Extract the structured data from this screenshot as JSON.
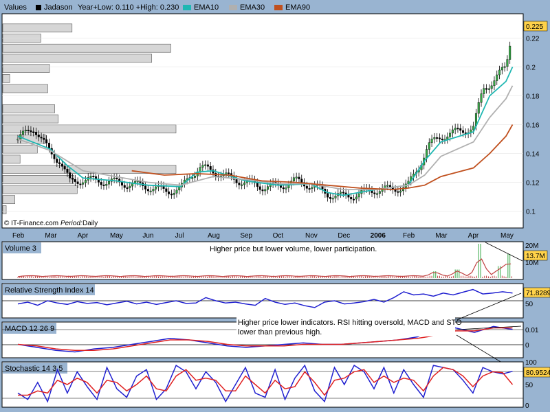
{
  "header": {
    "values_label": "Values",
    "symbol": "Jadason",
    "range_text": "Year+Low: 0.110 +High: 0.230",
    "legend": [
      {
        "name": "EMA10",
        "color": "#1fb7b2"
      },
      {
        "name": "EMA30",
        "color": "#b0b0b0"
      },
      {
        "name": "EMA90",
        "color": "#c0501e"
      }
    ]
  },
  "credit": {
    "source": "© IT-Finance.com",
    "period_label": "Period:",
    "period_value": "Daily"
  },
  "annotations": {
    "volume_note": "Higher price but lower volume, lower participation.",
    "indicator_note_line1": "Higher price lower indicators. RSI hitting oversold, MACD and STO",
    "indicator_note_line2": "lower than previous high."
  },
  "chart_data": [
    {
      "type": "line",
      "panel": "price",
      "title": "Jadason",
      "x_labels": [
        "Feb",
        "Mar",
        "Apr",
        "May",
        "Jun",
        "Jul",
        "Aug",
        "Sep",
        "Oct",
        "Nov",
        "Dec",
        "2006",
        "Feb",
        "Mar",
        "Apr",
        "May"
      ],
      "y_ticks": [
        0.1,
        0.12,
        0.14,
        0.16,
        0.18,
        0.2,
        0.22
      ],
      "ylim": [
        0.095,
        0.235
      ],
      "last_value": "0.225",
      "price_path": [
        [
          0,
          0.15
        ],
        [
          0.5,
          0.158
        ],
        [
          1,
          0.14
        ],
        [
          1.3,
          0.135
        ],
        [
          1.6,
          0.12
        ],
        [
          2,
          0.122
        ],
        [
          3,
          0.12
        ],
        [
          4,
          0.117
        ],
        [
          4.5,
          0.114
        ],
        [
          5,
          0.115
        ],
        [
          5.3,
          0.125
        ],
        [
          5.6,
          0.13
        ],
        [
          6,
          0.128
        ],
        [
          6.5,
          0.123
        ],
        [
          7,
          0.12
        ],
        [
          7.5,
          0.117
        ],
        [
          8,
          0.117
        ],
        [
          8.5,
          0.121
        ],
        [
          9,
          0.118
        ],
        [
          9.5,
          0.112
        ],
        [
          10,
          0.11
        ],
        [
          10.5,
          0.112
        ],
        [
          11,
          0.115
        ],
        [
          11.5,
          0.115
        ],
        [
          12,
          0.118
        ],
        [
          12.3,
          0.13
        ],
        [
          12.6,
          0.145
        ],
        [
          13,
          0.152
        ],
        [
          13.5,
          0.155
        ],
        [
          14,
          0.158
        ],
        [
          14.3,
          0.185
        ],
        [
          14.6,
          0.19
        ],
        [
          15,
          0.2
        ],
        [
          15.1,
          0.215
        ],
        [
          15.2,
          0.225
        ]
      ],
      "series": [
        {
          "name": "EMA10",
          "color": "#1fb7b2",
          "points": [
            [
              0,
              0.152
            ],
            [
              1,
              0.143
            ],
            [
              1.5,
              0.132
            ],
            [
              2,
              0.123
            ],
            [
              3,
              0.121
            ],
            [
              4,
              0.118
            ],
            [
              5,
              0.117
            ],
            [
              5.5,
              0.127
            ],
            [
              6,
              0.128
            ],
            [
              7,
              0.121
            ],
            [
              8,
              0.118
            ],
            [
              9,
              0.119
            ],
            [
              9.5,
              0.113
            ],
            [
              10,
              0.111
            ],
            [
              11,
              0.115
            ],
            [
              12,
              0.118
            ],
            [
              12.5,
              0.135
            ],
            [
              13,
              0.148
            ],
            [
              14,
              0.155
            ],
            [
              14.5,
              0.18
            ],
            [
              15,
              0.19
            ],
            [
              15.2,
              0.2
            ]
          ]
        },
        {
          "name": "EMA30",
          "color": "#b0b0b0",
          "points": [
            [
              0,
              0.15
            ],
            [
              1,
              0.142
            ],
            [
              2,
              0.128
            ],
            [
              3,
              0.124
            ],
            [
              4,
              0.12
            ],
            [
              5,
              0.118
            ],
            [
              6,
              0.124
            ],
            [
              7,
              0.122
            ],
            [
              8,
              0.119
            ],
            [
              9,
              0.119
            ],
            [
              10,
              0.115
            ],
            [
              11,
              0.115
            ],
            [
              12,
              0.118
            ],
            [
              12.5,
              0.125
            ],
            [
              13,
              0.138
            ],
            [
              14,
              0.148
            ],
            [
              14.5,
              0.165
            ],
            [
              15,
              0.178
            ],
            [
              15.2,
              0.187
            ]
          ]
        },
        {
          "name": "EMA90",
          "color": "#c0501e",
          "points": [
            [
              3.5,
              0.128
            ],
            [
              4.5,
              0.125
            ],
            [
              5.5,
              0.126
            ],
            [
              6.5,
              0.125
            ],
            [
              7.5,
              0.121
            ],
            [
              8.5,
              0.12
            ],
            [
              9.5,
              0.118
            ],
            [
              10.5,
              0.116
            ],
            [
              11.5,
              0.115
            ],
            [
              12,
              0.116
            ],
            [
              12.5,
              0.118
            ],
            [
              13,
              0.124
            ],
            [
              14,
              0.13
            ],
            [
              14.5,
              0.14
            ],
            [
              15,
              0.152
            ],
            [
              15.2,
              0.16
            ]
          ]
        }
      ],
      "volume_by_price": [
        {
          "price": 0.227,
          "relative": 0.4
        },
        {
          "price": 0.22,
          "relative": 0.22
        },
        {
          "price": 0.213,
          "relative": 0.97
        },
        {
          "price": 0.206,
          "relative": 0.86
        },
        {
          "price": 0.199,
          "relative": 0.27
        },
        {
          "price": 0.192,
          "relative": 0.04
        },
        {
          "price": 0.185,
          "relative": 0.26
        },
        {
          "price": 0.171,
          "relative": 0.3
        },
        {
          "price": 0.164,
          "relative": 0.32
        },
        {
          "price": 0.157,
          "relative": 1.0
        },
        {
          "price": 0.15,
          "relative": 0.25
        },
        {
          "price": 0.143,
          "relative": 0.2
        },
        {
          "price": 0.136,
          "relative": 0.1
        },
        {
          "price": 0.129,
          "relative": 1.0
        },
        {
          "price": 0.122,
          "relative": 0.41
        },
        {
          "price": 0.115,
          "relative": 0.43
        },
        {
          "price": 0.108,
          "relative": 0.07
        },
        {
          "price": 0.101,
          "relative": 0.02
        }
      ]
    },
    {
      "type": "bar",
      "panel": "volume",
      "title": "Volume 3",
      "y_ticks": [
        "20M",
        "10M"
      ],
      "last_value": "13.7M",
      "spikes": [
        {
          "x": 14.2,
          "value": 20
        },
        {
          "x": 14.8,
          "value": 7
        },
        {
          "x": 13.5,
          "value": 5
        },
        {
          "x": 12.8,
          "value": 4
        },
        {
          "x": 15.1,
          "value": 14
        }
      ]
    },
    {
      "type": "line",
      "panel": "rsi",
      "title": "Relative Strength Index 14",
      "y_ticks": [
        50
      ],
      "last_value": "71.8289",
      "values": [
        48,
        52,
        45,
        55,
        50,
        47,
        53,
        49,
        51,
        46,
        50,
        54,
        48,
        52,
        47,
        51,
        55,
        49,
        50,
        62,
        55,
        50,
        52,
        48,
        45,
        60,
        52,
        47,
        50,
        44,
        40,
        52,
        55,
        48,
        50,
        53,
        58,
        52,
        62,
        75,
        68,
        70,
        65,
        72,
        68,
        74,
        80,
        70,
        72,
        75,
        72
      ]
    },
    {
      "type": "line",
      "panel": "macd",
      "title": "MACD 12 26 9",
      "y_ticks": [
        0.01,
        0
      ],
      "series": [
        {
          "name": "MACD",
          "color": "#2020d0",
          "values": [
            0.0,
            -0.002,
            -0.004,
            -0.005,
            -0.003,
            -0.002,
            0.0,
            0.002,
            0.004,
            0.003,
            0.001,
            -0.001,
            -0.002,
            -0.001,
            0.0,
            0.001,
            0.0,
            0.0,
            0.001,
            0.002,
            0.003,
            0.005,
            0.01,
            0.011,
            0.008,
            0.012,
            0.01
          ]
        },
        {
          "name": "Signal",
          "color": "#e02020",
          "values": [
            0.0,
            -0.001,
            -0.003,
            -0.004,
            -0.004,
            -0.003,
            -0.001,
            0.001,
            0.003,
            0.003,
            0.002,
            0.0,
            -0.001,
            -0.001,
            -0.001,
            0.0,
            0.0,
            0.0,
            0.001,
            0.002,
            0.003,
            0.004,
            0.006,
            0.009,
            0.009,
            0.011,
            0.011
          ]
        }
      ]
    },
    {
      "type": "line",
      "panel": "stochastic",
      "title": "Stochastic 14 3 5",
      "y_ticks": [
        100,
        50,
        0
      ],
      "last_value": "80.9524",
      "series": [
        {
          "name": "%K",
          "color": "#2020d0",
          "values": [
            30,
            15,
            55,
            10,
            85,
            30,
            80,
            45,
            15,
            90,
            40,
            20,
            70,
            85,
            15,
            40,
            95,
            80,
            40,
            80,
            55,
            10,
            50,
            90,
            30,
            20,
            85,
            15,
            65,
            95,
            35,
            10,
            90,
            50,
            95,
            80,
            40,
            90,
            30,
            85,
            50,
            20,
            95,
            90,
            85,
            60,
            30,
            90,
            80,
            75,
            81
          ]
        },
        {
          "name": "%D",
          "color": "#e02020",
          "values": [
            25,
            25,
            35,
            30,
            60,
            50,
            65,
            55,
            30,
            60,
            55,
            35,
            50,
            70,
            40,
            35,
            70,
            85,
            60,
            65,
            60,
            35,
            35,
            70,
            50,
            30,
            60,
            40,
            45,
            80,
            55,
            25,
            60,
            65,
            80,
            85,
            55,
            70,
            55,
            65,
            60,
            35,
            70,
            90,
            85,
            70,
            45,
            70,
            80,
            78,
            50
          ]
        }
      ]
    }
  ]
}
